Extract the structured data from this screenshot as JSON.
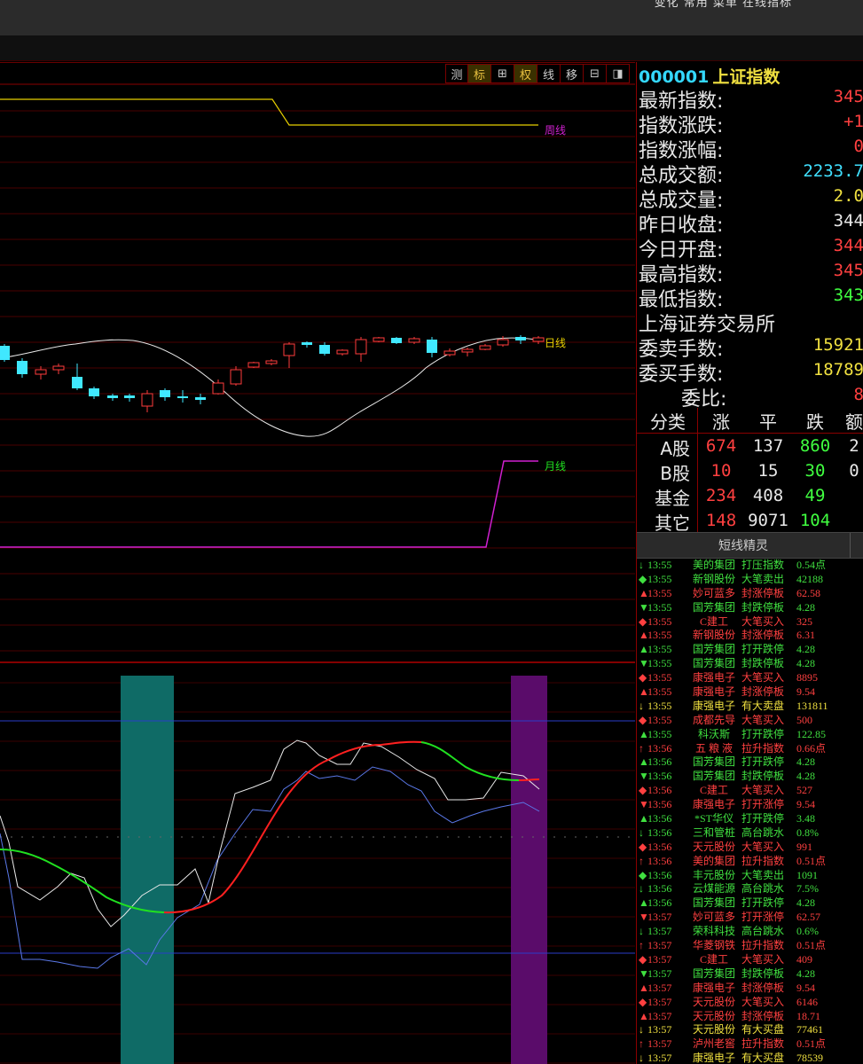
{
  "menu": "变化   常用   菜单   在线指标",
  "toolbar": [
    {
      "label": "测",
      "active": false
    },
    {
      "label": "标",
      "active": true
    },
    {
      "label": "⊞",
      "active": false
    },
    {
      "label": "权",
      "active": true
    },
    {
      "label": "线",
      "active": false
    },
    {
      "label": "移",
      "active": false
    },
    {
      "label": "⊟",
      "active": false
    },
    {
      "label": "◨",
      "active": false
    }
  ],
  "chart": {
    "weekly_label": "周线",
    "daily_label": "日线",
    "monthly_label": "月线",
    "colors": {
      "up": "#ff3c3c",
      "down": "#40e8ff",
      "weekly": "#e8d000",
      "monthly": "#d020d0",
      "ma": "#e8e8e8",
      "grid": "#5a0000",
      "band_left": "#0f6b66",
      "band_right": "#5a0c6a"
    }
  },
  "quote": {
    "code": "000001",
    "name": "上证指数",
    "rows": [
      {
        "label": "最新指数:",
        "value": "345",
        "color": "#ff4040"
      },
      {
        "label": "指数涨跌:",
        "value": "+1",
        "color": "#ff4040"
      },
      {
        "label": "指数涨幅:",
        "value": "0",
        "color": "#ff4040"
      },
      {
        "label": "总成交额:",
        "value": "2233.7",
        "color": "#40e0ff"
      },
      {
        "label": "总成交量:",
        "value": "2.0",
        "color": "#f0e040"
      },
      {
        "label": "昨日收盘:",
        "value": "344",
        "color": "#e8e8e8"
      },
      {
        "label": "今日开盘:",
        "value": "344",
        "color": "#ff4040"
      },
      {
        "label": "最高指数:",
        "value": "345",
        "color": "#ff4040"
      },
      {
        "label": "最低指数:",
        "value": "343",
        "color": "#40ff40"
      }
    ],
    "exchange": "上海证券交易所",
    "order_rows": [
      {
        "label": "委卖手数:",
        "value": "15921",
        "color": "#f0e040"
      },
      {
        "label": "委买手数:",
        "value": "18789",
        "color": "#f0e040"
      },
      {
        "label": "委比:",
        "value": "8",
        "color": "#ff4040"
      }
    ]
  },
  "breadth": {
    "headers": [
      "分类",
      "涨",
      "平",
      "跌",
      "额"
    ],
    "rows": [
      {
        "cat": "A股",
        "up": "674",
        "flat": "137",
        "down": "860",
        "amt": "2"
      },
      {
        "cat": "B股",
        "up": "10",
        "flat": "15",
        "down": "30",
        "amt": "0"
      },
      {
        "cat": "基金",
        "up": "234",
        "flat": "408",
        "down": "49",
        "amt": ""
      },
      {
        "cat": "其它",
        "up": "148",
        "flat": "9071",
        "down": "104",
        "amt": ""
      }
    ]
  },
  "sprite": {
    "title": "短线精灵",
    "feed": [
      {
        "icon": "↓",
        "time": "13:55",
        "name": "美的集团",
        "event": "打压指数",
        "value": "0.54点",
        "color": "#40e040"
      },
      {
        "icon": "◆",
        "time": "13:55",
        "name": "新钢股份",
        "event": "大笔卖出",
        "value": "42188",
        "color": "#40e040"
      },
      {
        "icon": "▲",
        "time": "13:55",
        "name": "妙可蓝多",
        "event": "封涨停板",
        "value": "62.58",
        "color": "#ff4040"
      },
      {
        "icon": "▼",
        "time": "13:55",
        "name": "国芳集团",
        "event": "封跌停板",
        "value": "4.28",
        "color": "#40e040"
      },
      {
        "icon": "◆",
        "time": "13:55",
        "name": "C建工",
        "event": "大笔买入",
        "value": "325",
        "color": "#ff4040"
      },
      {
        "icon": "▲",
        "time": "13:55",
        "name": "新钢股份",
        "event": "封涨停板",
        "value": "6.31",
        "color": "#ff4040"
      },
      {
        "icon": "▲",
        "time": "13:55",
        "name": "国芳集团",
        "event": "打开跌停",
        "value": "4.28",
        "color": "#40e040"
      },
      {
        "icon": "▼",
        "time": "13:55",
        "name": "国芳集团",
        "event": "封跌停板",
        "value": "4.28",
        "color": "#40e040"
      },
      {
        "icon": "◆",
        "time": "13:55",
        "name": "康强电子",
        "event": "大笔买入",
        "value": "8895",
        "color": "#ff4040"
      },
      {
        "icon": "▲",
        "time": "13:55",
        "name": "康强电子",
        "event": "封涨停板",
        "value": "9.54",
        "color": "#ff4040"
      },
      {
        "icon": "↓",
        "time": "13:55",
        "name": "康强电子",
        "event": "有大卖盘",
        "value": "131811",
        "color": "#f0e040"
      },
      {
        "icon": "◆",
        "time": "13:55",
        "name": "成都先导",
        "event": "大笔买入",
        "value": "500",
        "color": "#ff4040"
      },
      {
        "icon": "▲",
        "time": "13:55",
        "name": "科沃斯",
        "event": "打开跌停",
        "value": "122.85",
        "color": "#40e040"
      },
      {
        "icon": "↑",
        "time": "13:56",
        "name": "五 粮 液",
        "event": "拉升指数",
        "value": "0.66点",
        "color": "#ff4040"
      },
      {
        "icon": "▲",
        "time": "13:56",
        "name": "国芳集团",
        "event": "打开跌停",
        "value": "4.28",
        "color": "#40e040"
      },
      {
        "icon": "▼",
        "time": "13:56",
        "name": "国芳集团",
        "event": "封跌停板",
        "value": "4.28",
        "color": "#40e040"
      },
      {
        "icon": "◆",
        "time": "13:56",
        "name": "C建工",
        "event": "大笔买入",
        "value": "527",
        "color": "#ff4040"
      },
      {
        "icon": "▼",
        "time": "13:56",
        "name": "康强电子",
        "event": "打开涨停",
        "value": "9.54",
        "color": "#ff4040"
      },
      {
        "icon": "▲",
        "time": "13:56",
        "name": "*ST华仪",
        "event": "打开跌停",
        "value": "3.48",
        "color": "#40e040"
      },
      {
        "icon": "↓",
        "time": "13:56",
        "name": "三和管桩",
        "event": "高台跳水",
        "value": "0.8%",
        "color": "#40e040"
      },
      {
        "icon": "◆",
        "time": "13:56",
        "name": "天元股份",
        "event": "大笔买入",
        "value": "991",
        "color": "#ff4040"
      },
      {
        "icon": "↑",
        "time": "13:56",
        "name": "美的集团",
        "event": "拉升指数",
        "value": "0.51点",
        "color": "#ff4040"
      },
      {
        "icon": "◆",
        "time": "13:56",
        "name": "丰元股份",
        "event": "大笔卖出",
        "value": "1091",
        "color": "#40e040"
      },
      {
        "icon": "↓",
        "time": "13:56",
        "name": "云煤能源",
        "event": "高台跳水",
        "value": "7.5%",
        "color": "#40e040"
      },
      {
        "icon": "▲",
        "time": "13:56",
        "name": "国芳集团",
        "event": "打开跌停",
        "value": "4.28",
        "color": "#40e040"
      },
      {
        "icon": "▼",
        "time": "13:57",
        "name": "妙可蓝多",
        "event": "打开涨停",
        "value": "62.57",
        "color": "#ff4040"
      },
      {
        "icon": "↓",
        "time": "13:57",
        "name": "荣科科技",
        "event": "高台跳水",
        "value": "0.6%",
        "color": "#40e040"
      },
      {
        "icon": "↑",
        "time": "13:57",
        "name": "华菱钢铁",
        "event": "拉升指数",
        "value": "0.51点",
        "color": "#ff4040"
      },
      {
        "icon": "◆",
        "time": "13:57",
        "name": "C建工",
        "event": "大笔买入",
        "value": "409",
        "color": "#ff4040"
      },
      {
        "icon": "▼",
        "time": "13:57",
        "name": "国芳集团",
        "event": "封跌停板",
        "value": "4.28",
        "color": "#40e040"
      },
      {
        "icon": "▲",
        "time": "13:57",
        "name": "康强电子",
        "event": "封涨停板",
        "value": "9.54",
        "color": "#ff4040"
      },
      {
        "icon": "◆",
        "time": "13:57",
        "name": "天元股份",
        "event": "大笔买入",
        "value": "6146",
        "color": "#ff4040"
      },
      {
        "icon": "▲",
        "time": "13:57",
        "name": "天元股份",
        "event": "封涨停板",
        "value": "18.71",
        "color": "#ff4040"
      },
      {
        "icon": "↓",
        "time": "13:57",
        "name": "天元股份",
        "event": "有大买盘",
        "value": "77461",
        "color": "#f0e040"
      },
      {
        "icon": "↑",
        "time": "13:57",
        "name": "泸州老窖",
        "event": "拉升指数",
        "value": "0.51点",
        "color": "#ff4040"
      },
      {
        "icon": "↓",
        "time": "13:57",
        "name": "康强电子",
        "event": "有大买盘",
        "value": "78539",
        "color": "#f0e040"
      }
    ]
  }
}
